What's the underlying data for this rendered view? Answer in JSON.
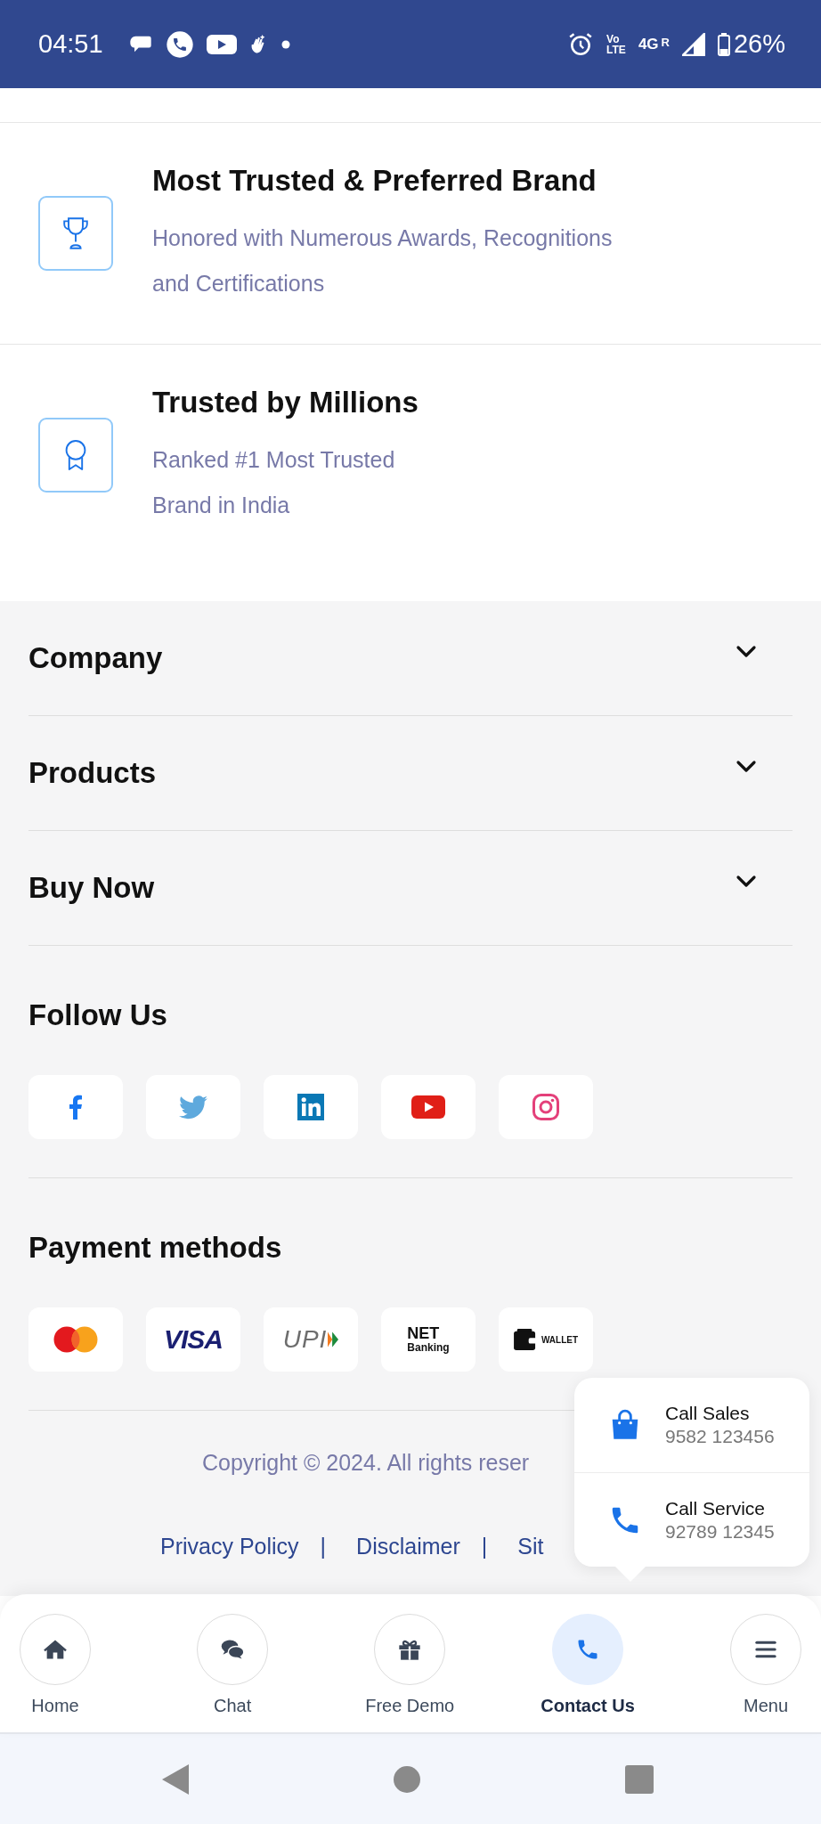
{
  "status_bar": {
    "time": "04:51",
    "volte": [
      "Vo",
      "LTE"
    ],
    "network": "4G",
    "roaming": "R",
    "battery": "26%"
  },
  "highlights": [
    {
      "kind": "trophy",
      "title": "Most Trusted & Preferred Brand",
      "lines": [
        "Honored with Numerous Awards, Recognitions",
        "and Certifications"
      ]
    },
    {
      "kind": "award",
      "title": "Trusted by Millions",
      "lines": [
        "Ranked #1 Most Trusted",
        "Brand in India"
      ]
    }
  ],
  "footer": {
    "sections": [
      {
        "title": "Company",
        "expanded": false
      },
      {
        "title": "Products",
        "expanded": false
      },
      {
        "title": "Buy Now",
        "expanded": false
      }
    ],
    "follow_us": {
      "title": "Follow Us",
      "links": [
        {
          "kind": "facebook"
        },
        {
          "kind": "twitter"
        },
        {
          "kind": "linkedin"
        },
        {
          "kind": "youtube"
        },
        {
          "kind": "instagram"
        }
      ]
    },
    "payment_methods": {
      "title": "Payment methods",
      "items": [
        {
          "kind": "mastercard"
        },
        {
          "kind": "visa",
          "label": "VISA"
        },
        {
          "kind": "upi",
          "label": "UPI"
        },
        {
          "kind": "netbanking",
          "label": "NET",
          "sublabel": "Banking"
        },
        {
          "kind": "wallet",
          "label": "WALLET"
        }
      ]
    },
    "copyright": "Copyright © 2024. All rights reser",
    "links": [
      "Privacy Policy",
      "Disclaimer",
      "Sit"
    ],
    "link_separators": [
      "|",
      "|"
    ]
  },
  "contact_popup": [
    {
      "kind": "bag",
      "title": "Call Sales",
      "number": "9582 123456"
    },
    {
      "kind": "phone",
      "title": "Call Service",
      "number": "92789 12345"
    }
  ],
  "bottom_nav": [
    {
      "kind": "home",
      "label": "Home",
      "selected": false
    },
    {
      "kind": "chat",
      "label": "Chat",
      "selected": false
    },
    {
      "kind": "gift",
      "label": "Free Demo",
      "selected": false
    },
    {
      "kind": "phone",
      "label": "Contact Us",
      "selected": true
    },
    {
      "kind": "menu",
      "label": "Menu",
      "selected": false
    }
  ]
}
